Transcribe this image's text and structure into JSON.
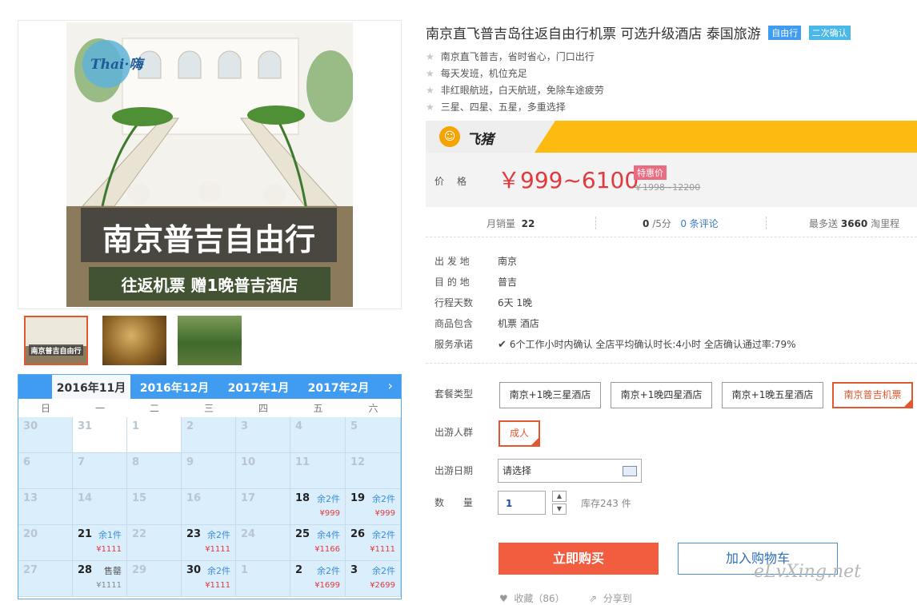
{
  "product": {
    "title": "南京直飞普吉岛往返自由行机票 可选升级酒店 泰国旅游",
    "tags": [
      "自由行",
      "二次确认"
    ],
    "features": [
      "南京直飞普吉，省时省心，门口出行",
      "每天发班，机位充足",
      "非红眼航班，白天航班，免除车途疲劳",
      "三星、四星、五星，多重选择"
    ]
  },
  "gallery": {
    "logo_text": "Thai·嗨",
    "main_title": "南京普吉自由行",
    "main_subtitle": "往返机票  赠1晚普吉酒店",
    "thumb1_title": "南京普吉自由行"
  },
  "platform": {
    "name": "飞猪",
    "logo_glyph": "☺"
  },
  "price": {
    "label": "价格",
    "value": "￥999~6100",
    "promo_label": "特惠价",
    "original": "￥1998~12200"
  },
  "stats": {
    "monthly_sales_label": "月销量",
    "monthly_sales": "22",
    "rating": "0",
    "rating_suffix": "/5分",
    "reviews": "0 条评论",
    "points_prefix": "最多送",
    "points_value": "3660",
    "points_suffix": "淘里程"
  },
  "attributes": [
    {
      "key": "出 发 地",
      "value": "南京"
    },
    {
      "key": "目 的 地",
      "value": "普吉"
    },
    {
      "key": "行程天数",
      "value": "6天 1晚"
    },
    {
      "key": "商品包含",
      "value": "机票   酒店"
    },
    {
      "key": "服务承诺",
      "value": "6个工作小时内确认     全店平均确认时长:4小时     全店确认通过率:79%"
    }
  ],
  "package": {
    "label": "套餐类型",
    "options": [
      "南京+1晚三星酒店",
      "南京+1晚四星酒店",
      "南京+1晚五星酒店",
      "南京普吉机票"
    ],
    "selected_index": 3
  },
  "travelers": {
    "label": "出游人群",
    "options": [
      "成人"
    ]
  },
  "date": {
    "label": "出游日期",
    "placeholder": "请选择"
  },
  "quantity": {
    "label": "数 量",
    "value": "1",
    "stock": "库存243 件"
  },
  "actions": {
    "buy": "立即购买",
    "cart": "加入购物车",
    "favorite": "收藏（86）",
    "share": "分享到"
  },
  "watermark": "eLvXing.net",
  "calendar": {
    "tabs": [
      "2016年11月",
      "2016年12月",
      "2017年1月",
      "2017年2月"
    ],
    "active_tab": 0,
    "weekdays": [
      "日",
      "一",
      "二",
      "三",
      "四",
      "五",
      "六"
    ],
    "weeks": [
      [
        {
          "d": "30"
        },
        {
          "d": "31"
        },
        {
          "d": "1"
        },
        {
          "d": "2"
        },
        {
          "d": "3"
        },
        {
          "d": "4"
        },
        {
          "d": "5"
        }
      ],
      [
        {
          "d": "6"
        },
        {
          "d": "7"
        },
        {
          "d": "8"
        },
        {
          "d": "9"
        },
        {
          "d": "10"
        },
        {
          "d": "11"
        },
        {
          "d": "12"
        }
      ],
      [
        {
          "d": "13"
        },
        {
          "d": "14"
        },
        {
          "d": "15"
        },
        {
          "d": "16"
        },
        {
          "d": "17"
        },
        {
          "d": "18",
          "s": "余2件",
          "p": "¥999"
        },
        {
          "d": "19",
          "s": "余2件",
          "p": "¥999"
        }
      ],
      [
        {
          "d": "20"
        },
        {
          "d": "21",
          "s": "余1件",
          "p": "¥1111"
        },
        {
          "d": "22"
        },
        {
          "d": "23",
          "s": "余2件",
          "p": "¥1111"
        },
        {
          "d": "24"
        },
        {
          "d": "25",
          "s": "余4件",
          "p": "¥1166"
        },
        {
          "d": "26",
          "s": "余2件",
          "p": "¥1111"
        }
      ],
      [
        {
          "d": "27"
        },
        {
          "d": "28",
          "s": "售罄",
          "p": "¥1111",
          "sold": true
        },
        {
          "d": "29"
        },
        {
          "d": "30",
          "s": "余2件",
          "p": "¥1111"
        },
        {
          "d": "1"
        },
        {
          "d": "2",
          "s": "余2件",
          "p": "¥1699"
        },
        {
          "d": "3",
          "s": "余2件",
          "p": "¥2699"
        }
      ]
    ]
  },
  "colors": {
    "accent_orange": "#f25c3f",
    "fliggy_yellow": "#fdbb12",
    "calendar_blue": "#3f9cf0",
    "price_red": "#e4393c"
  }
}
